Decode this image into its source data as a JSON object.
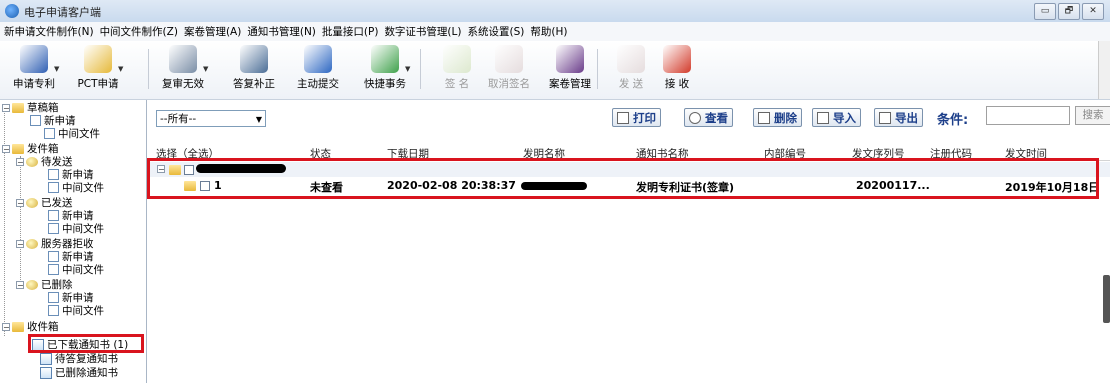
{
  "window": {
    "title": "电子申请客户端",
    "controls": [
      "▭",
      "🗗",
      "✕"
    ]
  },
  "menu": [
    "新申请文件制作(N)",
    "中间文件制作(Z)",
    "案卷管理(A)",
    "通知书管理(N)",
    "批量接口(P)",
    "数字证书管理(L)",
    "系统设置(S)",
    "帮助(H)"
  ],
  "toolbar": {
    "buttons": [
      {
        "label": "申请专利",
        "icon": "apply-patent-icon",
        "color": "#2f5fb3",
        "disabled": false,
        "dropdown": true
      },
      {
        "label": "PCT申请",
        "icon": "pct-icon",
        "color": "#e6b93a",
        "disabled": false,
        "dropdown": true
      },
      {
        "label": "复审无效",
        "icon": "review-icon",
        "color": "#7a8ea6",
        "disabled": false,
        "dropdown": true
      },
      {
        "label": "答复补正",
        "icon": "reply-icon",
        "color": "#4a6d96",
        "disabled": false,
        "dropdown": false
      },
      {
        "label": "主动提交",
        "icon": "submit-icon",
        "color": "#2d67c2",
        "disabled": false,
        "dropdown": false
      },
      {
        "label": "快捷事务",
        "icon": "quick-affairs-icon",
        "color": "#3fa14b",
        "disabled": false,
        "dropdown": true
      },
      {
        "label": "签 名",
        "icon": "sign-icon",
        "color": "#c8dcaa",
        "disabled": true,
        "dropdown": false
      },
      {
        "label": "取消签名",
        "icon": "cancel-sign-icon",
        "color": "#d8c6c6",
        "disabled": true,
        "dropdown": false
      },
      {
        "label": "案卷管理",
        "icon": "archive-icon",
        "color": "#6a3c8a",
        "disabled": false,
        "dropdown": false
      },
      {
        "label": "发 送",
        "icon": "send-icon",
        "color": "#d8c6c6",
        "disabled": true,
        "dropdown": false
      },
      {
        "label": "接 收",
        "icon": "receive-icon",
        "color": "#d23a2a",
        "disabled": false,
        "dropdown": false
      }
    ]
  },
  "tree": {
    "drafts": {
      "label": "草稿箱",
      "children": [
        "新申请",
        "中间文件"
      ]
    },
    "outbox": {
      "label": "发件箱",
      "groups": [
        {
          "label": "待发送",
          "children": [
            "新申请",
            "中间文件"
          ]
        },
        {
          "label": "已发送",
          "children": [
            "新申请",
            "中间文件"
          ]
        },
        {
          "label": "服务器拒收",
          "children": [
            "新申请",
            "中间文件"
          ]
        },
        {
          "label": "已删除",
          "children": [
            "新申请",
            "中间文件"
          ]
        }
      ]
    },
    "inbox": {
      "label": "收件箱",
      "children": [
        "已下载通知书 (1)",
        "待答复通知书",
        "已删除通知书"
      ]
    }
  },
  "filter": {
    "select_value": "--所有--",
    "actions": [
      "打印",
      "查看",
      "删除",
      "导入",
      "导出"
    ],
    "condition_label": "条件:",
    "search_label": "搜索"
  },
  "grid": {
    "columns": [
      "选择（全选）",
      "状态",
      "下载日期",
      "发明名称",
      "通知书名称",
      "内部编号",
      "发文序列号",
      "注册代码",
      "发文时间"
    ],
    "rows": [
      {
        "index": "1",
        "status": "未查看",
        "download_date": "2020-02-08 20:38:37",
        "notice_name": "发明专利证书(签章)",
        "internal_no": "",
        "serial_no": "20200117...",
        "reg_code": "",
        "issue_time": "2019年10月18日"
      }
    ]
  },
  "colors": {
    "highlight": "#d9141e",
    "accent": "#1d3f8a"
  }
}
